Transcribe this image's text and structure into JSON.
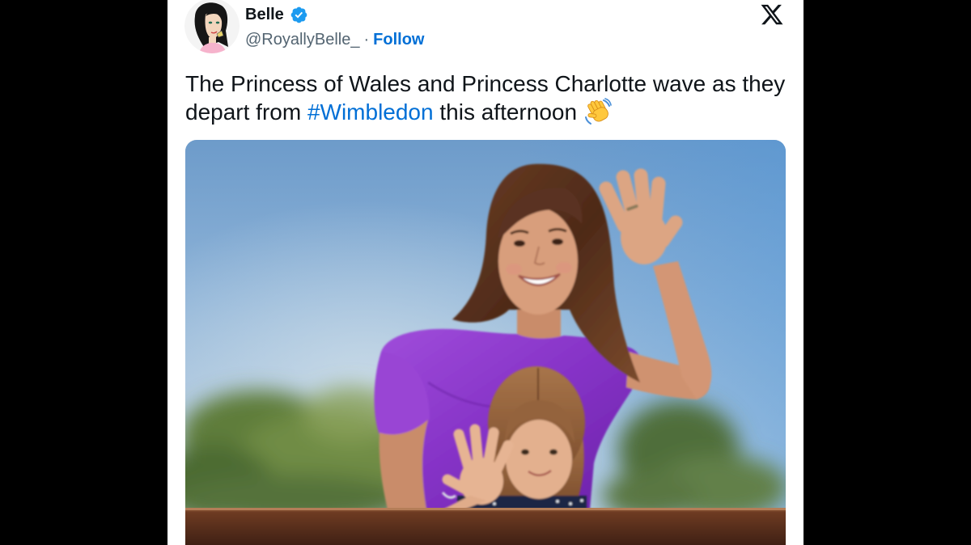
{
  "author": {
    "name": "Belle",
    "handle": "@RoyallyBelle_",
    "separator": "·",
    "follow_label": "Follow"
  },
  "tweet": {
    "line1": "The Princess of Wales and Princess Charlotte wave as they",
    "line2_prefix": "depart from ",
    "hashtag": "#Wimbledon",
    "line2_suffix": " this afternoon"
  },
  "icons": {
    "verified": "verified-badge-icon",
    "platform_logo": "x-logo-icon",
    "emoji": "waving-hand-icon"
  },
  "colors": {
    "text": "#0f1419",
    "secondary_text": "#536471",
    "link": "#006fd6",
    "verified_badge": "#1d9bf0",
    "page_background": "#000000",
    "card_background": "#ffffff"
  }
}
